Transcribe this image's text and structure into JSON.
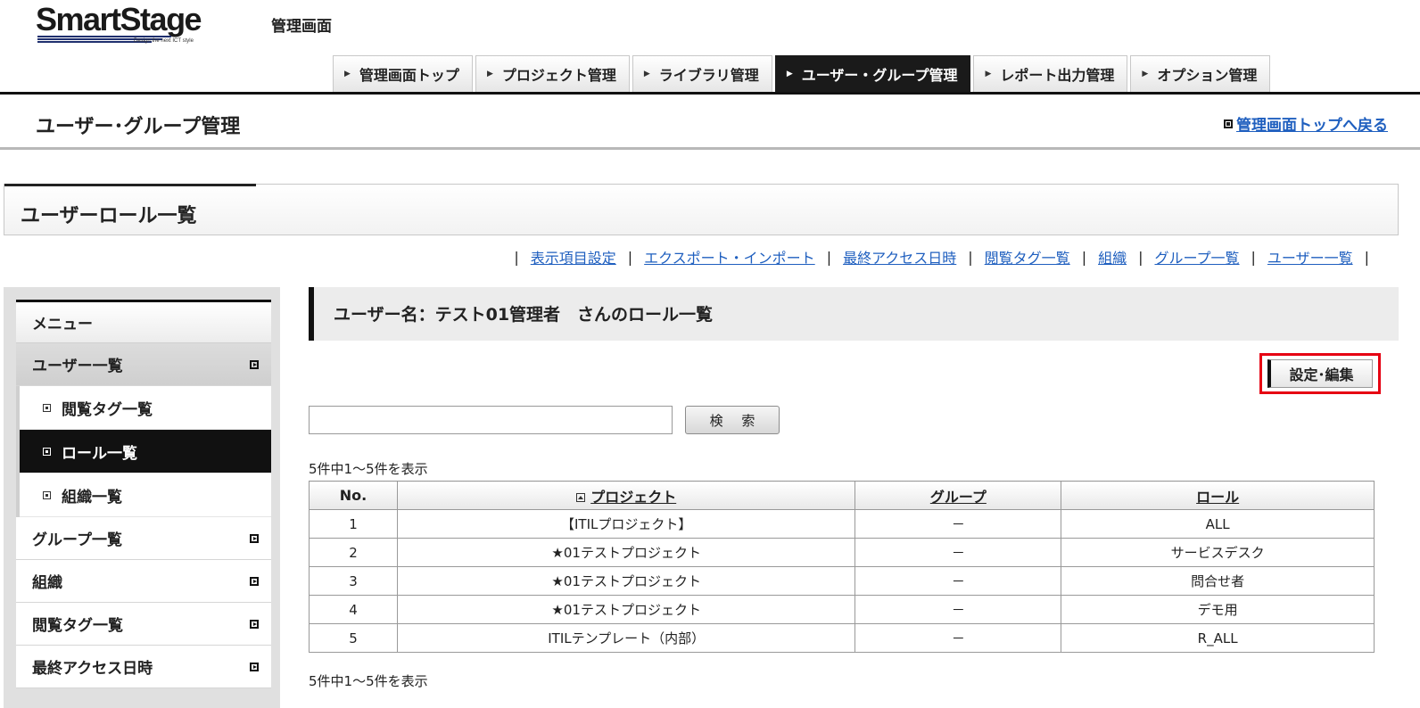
{
  "header": {
    "logo_text": "SmartStage",
    "logo_tagline": "Design the next ICT style",
    "admin_label": "管理画面"
  },
  "global_nav": [
    {
      "label": "管理画面トップ",
      "active": false
    },
    {
      "label": "プロジェクト管理",
      "active": false
    },
    {
      "label": "ライブラリ管理",
      "active": false
    },
    {
      "label": "ユーザー・グループ管理",
      "active": true
    },
    {
      "label": "レポート出力管理",
      "active": false
    },
    {
      "label": "オプション管理",
      "active": false
    }
  ],
  "page": {
    "title": "ユーザー･グループ管理",
    "back_link": "管理画面トップへ戻る"
  },
  "section": {
    "title": "ユーザーロール一覧"
  },
  "sublinks": [
    "表示項目設定",
    "エクスポート・インポート",
    "最終アクセス日時",
    "閲覧タグ一覧",
    "組織",
    "グループ一覧",
    "ユーザー一覧"
  ],
  "sidebar": {
    "menu_label": "メニュー",
    "items": [
      {
        "label": "ユーザー一覧",
        "open": true,
        "children": [
          {
            "label": "閲覧タグ一覧",
            "active": false
          },
          {
            "label": "ロール一覧",
            "active": true
          },
          {
            "label": "組織一覧",
            "active": false
          }
        ]
      },
      {
        "label": "グループ一覧",
        "open": false
      },
      {
        "label": "組織",
        "open": false
      },
      {
        "label": "閲覧タグ一覧",
        "open": false
      },
      {
        "label": "最終アクセス日時",
        "open": false
      }
    ]
  },
  "main": {
    "heading": "ユーザー名：テスト01管理者　さんのロール一覧",
    "edit_button": "設定･編集",
    "search": {
      "value": "",
      "placeholder": "",
      "button_label": "検 索"
    },
    "count_top": "5件中1～5件を表示",
    "count_bottom": "5件中1～5件を表示",
    "table": {
      "columns": [
        "No.",
        "プロジェクト",
        "グループ",
        "ロール"
      ],
      "rows": [
        [
          "1",
          "【ITILプロジェクト】",
          "－",
          "ALL"
        ],
        [
          "2",
          "★01テストプロジェクト",
          "－",
          "サービスデスク"
        ],
        [
          "3",
          "★01テストプロジェクト",
          "－",
          "問合せ者"
        ],
        [
          "4",
          "★01テストプロジェクト",
          "－",
          "デモ用"
        ],
        [
          "5",
          "ITILテンプレート（内部）",
          "－",
          "R_ALL"
        ]
      ]
    }
  },
  "colors": {
    "accent_dark": "#1a1a1a",
    "link_blue": "#1f5fbf",
    "highlight_red": "#e60012"
  }
}
